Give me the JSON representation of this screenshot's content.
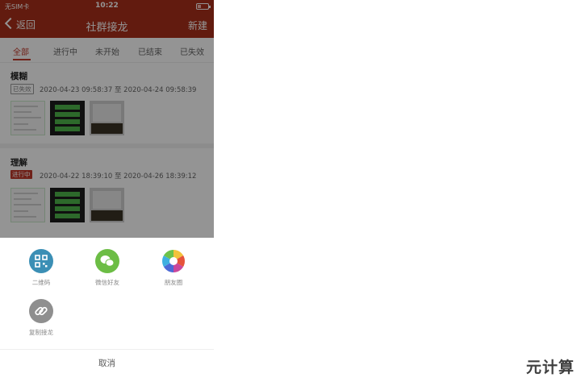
{
  "status": {
    "carrier": "无SIM卡",
    "time": "10:22"
  },
  "nav": {
    "back_label": "返回",
    "title": "社群接龙",
    "new_label": "新建"
  },
  "tabs": [
    "全部",
    "进行中",
    "未开始",
    "已结束",
    "已失效"
  ],
  "active_tab": "全部",
  "items": [
    {
      "name": "模糊",
      "status": "已失效",
      "range": "2020-04-23 09:58:37 至 2020-04-24 09:58:39"
    },
    {
      "name": "理解",
      "status": "进行中",
      "range": "2020-04-22 18:39:10 至 2020-04-26 18:39:12"
    }
  ],
  "share": [
    {
      "label": "二维码",
      "icon": "qrcode-icon"
    },
    {
      "label": "微信好友",
      "icon": "wechat-icon"
    },
    {
      "label": "朋友圈",
      "icon": "moments-icon"
    },
    {
      "label": "复制接龙",
      "icon": "link-icon"
    }
  ],
  "cancel_label": "取消",
  "watermark": "元计算",
  "colors": {
    "brand": "#a9301b",
    "accent": "#c0392b"
  }
}
